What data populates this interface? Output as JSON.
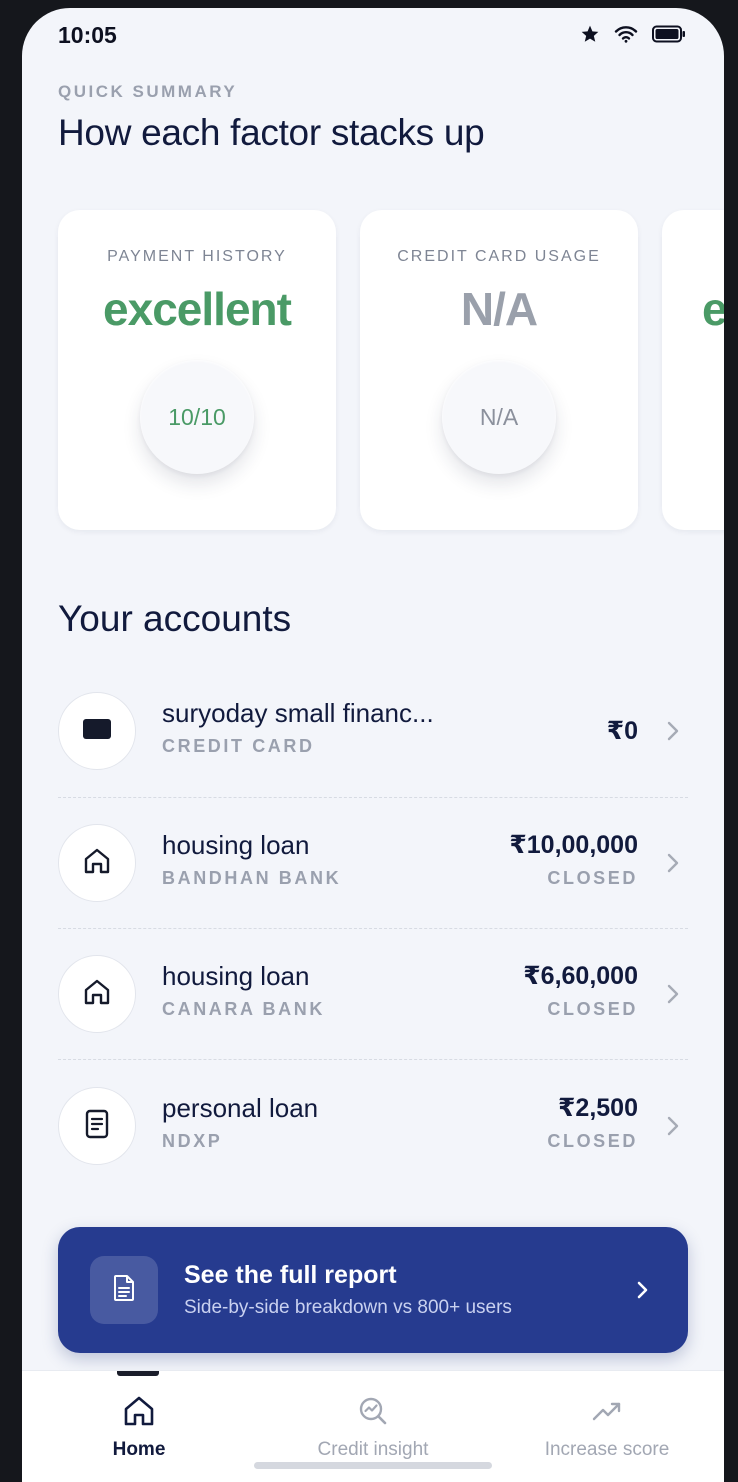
{
  "status_bar": {
    "time": "10:05"
  },
  "summary": {
    "eyebrow": "QUICK SUMMARY",
    "title": "How each factor stacks up",
    "cards": [
      {
        "label": "PAYMENT HISTORY",
        "rating": "excellent",
        "score": "10/10"
      },
      {
        "label": "CREDIT CARD USAGE",
        "rating": "N/A",
        "score": "N/A"
      },
      {
        "label": "",
        "rating": "e",
        "score": ""
      }
    ]
  },
  "accounts": {
    "title": "Your accounts",
    "items": [
      {
        "name": "suryoday small financ...",
        "sub": "CREDIT CARD",
        "amount": "₹0",
        "status": "",
        "icon": "credit-card-icon"
      },
      {
        "name": "housing loan",
        "sub": "BANDHAN BANK",
        "amount": "₹10,00,000",
        "status": "CLOSED",
        "icon": "house-icon"
      },
      {
        "name": "housing loan",
        "sub": "CANARA BANK",
        "amount": "₹6,60,000",
        "status": "CLOSED",
        "icon": "house-icon"
      },
      {
        "name": "personal loan",
        "sub": "NDXP",
        "amount": "₹2,500",
        "status": "CLOSED",
        "icon": "document-icon"
      }
    ]
  },
  "report_banner": {
    "title": "See the full report",
    "subtitle": "Side-by-side breakdown vs 800+ users"
  },
  "tabbar": {
    "tabs": [
      {
        "label": "Home",
        "icon": "home-icon",
        "active": true
      },
      {
        "label": "Credit insight",
        "icon": "insight-icon",
        "active": false
      },
      {
        "label": "Increase score",
        "icon": "trending-up-icon",
        "active": false
      }
    ]
  },
  "colors": {
    "accent_green": "#4a9a66",
    "banner_blue": "#263b8f",
    "text_dark": "#111a3d",
    "muted": "#9aa0ae"
  }
}
